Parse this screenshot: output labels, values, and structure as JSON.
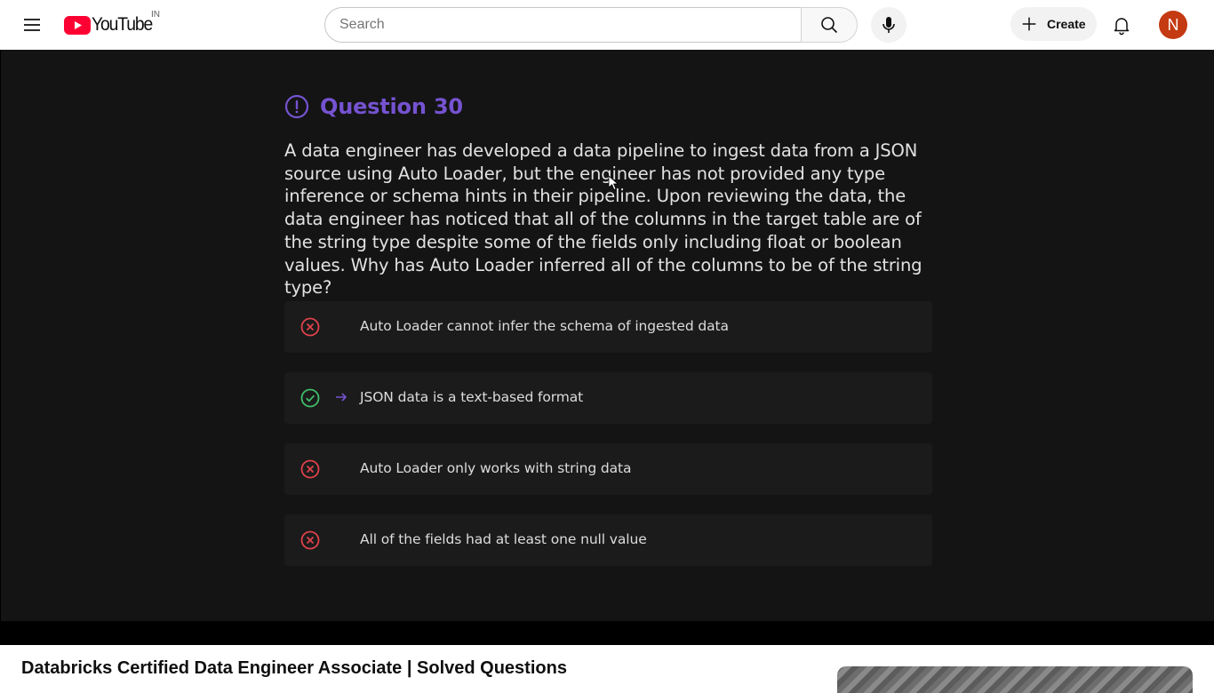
{
  "masthead": {
    "logo_text": "YouTube",
    "country_code": "IN",
    "search_placeholder": "Search",
    "create_label": "Create",
    "avatar_initial": "N",
    "icons": {
      "menu": "hamburger-menu-icon",
      "search": "search-icon",
      "mic": "microphone-icon",
      "create": "plus-icon",
      "notifications": "bell-icon"
    }
  },
  "player": {
    "question_title": "Question 30",
    "question_text": "A data engineer has developed a data pipeline to ingest data from a JSON source using Auto Loader, but the engineer has not provided any type inference or schema hints in their pipeline. Upon reviewing the data, the data engineer has noticed that all of the columns in the target table are of the string type despite some of the fields only including float or boolean values. Why has Auto Loader inferred all of the columns to be of the string type?",
    "options": [
      {
        "label": "Auto Loader cannot infer the schema of ingested data",
        "status": "incorrect"
      },
      {
        "label": "JSON data is a text-based format",
        "status": "correct"
      },
      {
        "label": "Auto Loader only works with string data",
        "status": "incorrect"
      },
      {
        "label": "All of the fields had at least one null value",
        "status": "incorrect"
      }
    ],
    "colors": {
      "accent": "#7553d1",
      "correct": "#3fbf6a",
      "incorrect": "#e0424b"
    }
  },
  "video": {
    "title": "Databricks Certified Data Engineer Associate | Solved Questions"
  }
}
